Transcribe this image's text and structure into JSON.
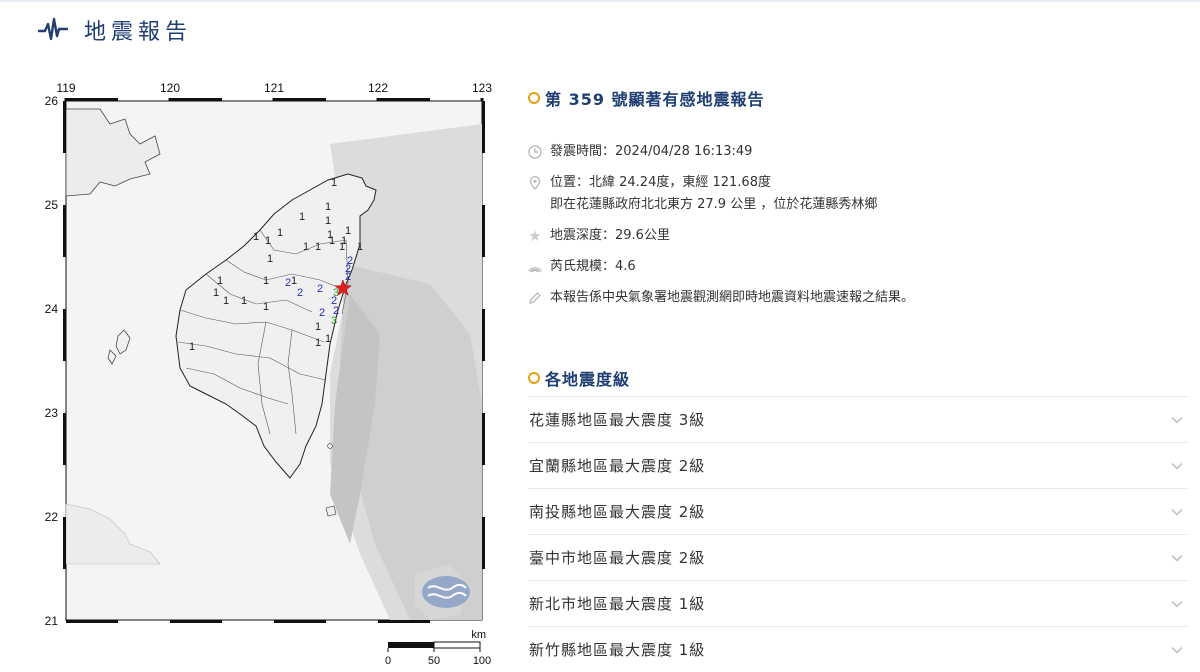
{
  "header": {
    "title": "地震報告",
    "icon": "seismograph-icon",
    "accent": "#1f3f73"
  },
  "map": {
    "lon_ticks": [
      "119",
      "120",
      "121",
      "122",
      "123"
    ],
    "lat_ticks": [
      "26",
      "25",
      "24",
      "23",
      "22",
      "21"
    ],
    "scale": {
      "unit": "km",
      "labels": [
        "0",
        "50",
        "100"
      ]
    },
    "epicenter_symbol": "star-marker",
    "station_intensities": [
      {
        "v": "1",
        "c": "#222"
      },
      {
        "v": "1",
        "c": "#222"
      },
      {
        "v": "1",
        "c": "#222"
      },
      {
        "v": "1",
        "c": "#222"
      },
      {
        "v": "1",
        "c": "#222"
      },
      {
        "v": "1",
        "c": "#222"
      },
      {
        "v": "1",
        "c": "#222"
      },
      {
        "v": "1",
        "c": "#222"
      },
      {
        "v": "1",
        "c": "#222"
      },
      {
        "v": "1",
        "c": "#222"
      },
      {
        "v": "1",
        "c": "#222"
      },
      {
        "v": "1",
        "c": "#222"
      },
      {
        "v": "1",
        "c": "#222"
      },
      {
        "v": "1",
        "c": "#222"
      },
      {
        "v": "1",
        "c": "#222"
      },
      {
        "v": "1",
        "c": "#222"
      },
      {
        "v": "1",
        "c": "#222"
      },
      {
        "v": "1",
        "c": "#222"
      },
      {
        "v": "1",
        "c": "#222"
      },
      {
        "v": "1",
        "c": "#222"
      },
      {
        "v": "1",
        "c": "#222"
      },
      {
        "v": "1",
        "c": "#222"
      },
      {
        "v": "1",
        "c": "#222"
      },
      {
        "v": "1",
        "c": "#222"
      },
      {
        "v": "2",
        "c": "#2a2ab8"
      },
      {
        "v": "2",
        "c": "#2a2ab8"
      },
      {
        "v": "2",
        "c": "#2a2ab8"
      },
      {
        "v": "2",
        "c": "#2a2ab8"
      },
      {
        "v": "2",
        "c": "#2a2ab8"
      },
      {
        "v": "2",
        "c": "#2a2ab8"
      },
      {
        "v": "2",
        "c": "#2a2ab8"
      },
      {
        "v": "2",
        "c": "#2a2ab8"
      },
      {
        "v": "2",
        "c": "#2a2ab8"
      },
      {
        "v": "3",
        "c": "#2a9a2a"
      },
      {
        "v": "3",
        "c": "#2a9a2a"
      }
    ]
  },
  "report": {
    "title": "第 359 號顯著有感地震報告",
    "time": "發震時間：2024/04/28 16:13:49",
    "location_line1": "位置：北緯 24.24度，東經 121.68度",
    "location_line2": "即在花蓮縣政府北北東方 27.9 公里 ，位於花蓮縣秀林鄉",
    "depth": "地震深度：29.6公里",
    "magnitude": "芮氏規模：4.6",
    "note": "本報告係中央氣象署地震觀測網即時地震資料地震速報之結果。",
    "icons": [
      "clock-icon",
      "location-pin-icon",
      "depth-star-icon",
      "wave-icon",
      "pen-icon"
    ]
  },
  "intensity": {
    "title": "各地震度級",
    "items": [
      {
        "label": "花蓮縣地區最大震度 3級"
      },
      {
        "label": "宜蘭縣地區最大震度 2級"
      },
      {
        "label": "南投縣地區最大震度 2級"
      },
      {
        "label": "臺中市地區最大震度 2級"
      },
      {
        "label": "新北市地區最大震度 1級"
      },
      {
        "label": "新竹縣地區最大震度 1級"
      }
    ]
  },
  "colors": {
    "dot": "#e5a11a",
    "star": "#e02020"
  }
}
